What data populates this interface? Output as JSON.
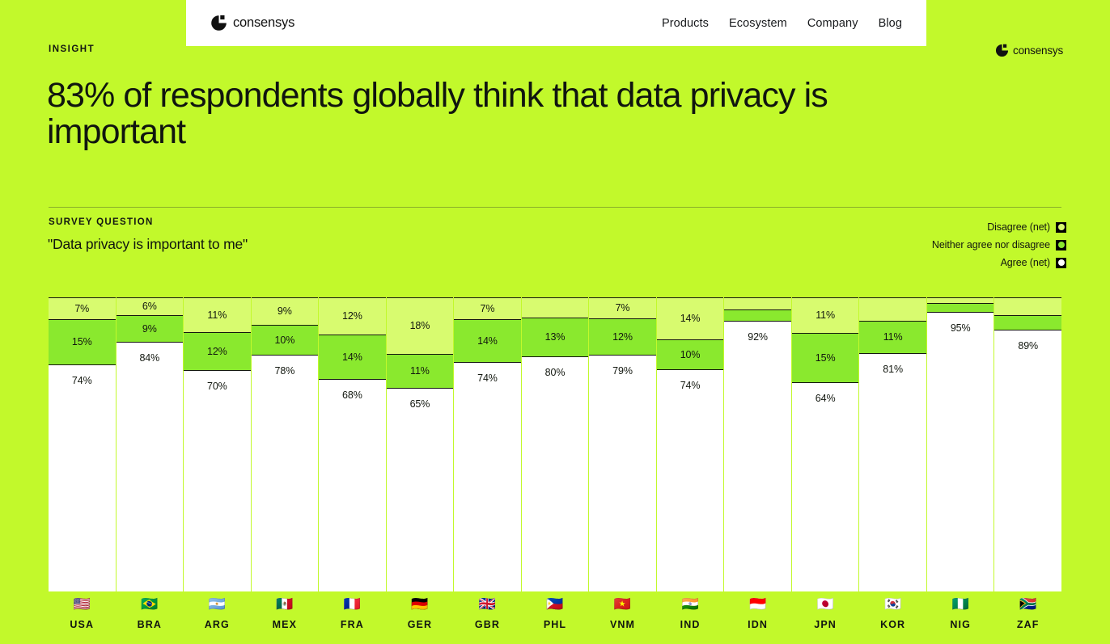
{
  "navbar": {
    "brand": "consensys",
    "brand_icon": "consensys-logo-icon",
    "links": [
      {
        "label": "Products"
      },
      {
        "label": "Ecosystem"
      },
      {
        "label": "Company"
      },
      {
        "label": "Blog"
      }
    ]
  },
  "corner_logo": {
    "brand": "consensys",
    "icon": "consensys-logo-icon"
  },
  "hero": {
    "eyebrow": "INSIGHT",
    "headline": "83% of respondents globally think that data privacy is important"
  },
  "survey": {
    "label": "SURVEY QUESTION",
    "question": "\"Data privacy is important to me\""
  },
  "legend": {
    "items": [
      {
        "label": "Disagree (net)",
        "color": "#d8fb6f"
      },
      {
        "label": "Neither agree nor disagree",
        "color": "#8ae92e"
      },
      {
        "label": "Agree (net)",
        "color": "#ffffff"
      }
    ]
  },
  "colors": {
    "background": "#c2f92b",
    "disagree": "#d8fb6f",
    "neither": "#8ae92e",
    "agree": "#ffffff",
    "stroke": "#13170f"
  },
  "chart_data": {
    "type": "bar",
    "title": "\"Data privacy is important to me\"",
    "subtype": "stacked-100-percent-vertical",
    "xlabel": "",
    "ylabel": "",
    "ylim": [
      0,
      100
    ],
    "grid": false,
    "legend_position": "top-right",
    "categories": [
      "USA",
      "BRA",
      "ARG",
      "MEX",
      "FRA",
      "GER",
      "GBR",
      "PHL",
      "VNM",
      "IND",
      "IDN",
      "JPN",
      "KOR",
      "NIG",
      "ZAF"
    ],
    "category_icons": [
      "🇺🇸",
      "🇧🇷",
      "🇦🇷",
      "🇲🇽",
      "🇫🇷",
      "🇩🇪",
      "🇬🇧",
      "🇵🇭",
      "🇻🇳",
      "🇮🇳",
      "🇮🇩",
      "🇯🇵",
      "🇰🇷",
      "🇳🇬",
      "🇿🇦"
    ],
    "series": [
      {
        "name": "Disagree (net)",
        "color": "#d8fb6f",
        "values": [
          7,
          6,
          11,
          9,
          12,
          18,
          7,
          7,
          7,
          14,
          4,
          11,
          8,
          2,
          6
        ]
      },
      {
        "name": "Neither agree nor disagree",
        "color": "#8ae92e",
        "values": [
          15,
          9,
          12,
          10,
          14,
          11,
          14,
          13,
          12,
          10,
          4,
          15,
          11,
          3,
          5
        ]
      },
      {
        "name": "Agree (net)",
        "color": "#ffffff",
        "values": [
          74,
          84,
          70,
          78,
          68,
          65,
          74,
          80,
          79,
          74,
          92,
          64,
          81,
          95,
          89
        ]
      }
    ],
    "bars": [
      {
        "country": "USA",
        "flag": "🇺🇸",
        "segments": [
          {
            "series": "Disagree (net)",
            "value": 7,
            "label": "7%",
            "color": "#d8fb6f"
          },
          {
            "series": "Neither agree nor disagree",
            "value": 15,
            "label": "15%",
            "color": "#8ae92e"
          },
          {
            "series": "Agree (net)",
            "value": 74,
            "label": "74%",
            "color": "#ffffff"
          }
        ]
      },
      {
        "country": "BRA",
        "flag": "🇧🇷",
        "segments": [
          {
            "series": "Disagree (net)",
            "value": 6,
            "label": "6%",
            "color": "#d8fb6f"
          },
          {
            "series": "Neither agree nor disagree",
            "value": 9,
            "label": "9%",
            "color": "#8ae92e"
          },
          {
            "series": "Agree (net)",
            "value": 84,
            "label": "84%",
            "color": "#ffffff"
          }
        ]
      },
      {
        "country": "ARG",
        "flag": "🇦🇷",
        "segments": [
          {
            "series": "Disagree (net)",
            "value": 11,
            "label": "11%",
            "color": "#d8fb6f"
          },
          {
            "series": "Neither agree nor disagree",
            "value": 12,
            "label": "12%",
            "color": "#8ae92e"
          },
          {
            "series": "Agree (net)",
            "value": 70,
            "label": "70%",
            "color": "#ffffff"
          }
        ]
      },
      {
        "country": "MEX",
        "flag": "🇲🇽",
        "segments": [
          {
            "series": "Disagree (net)",
            "value": 9,
            "label": "9%",
            "color": "#d8fb6f"
          },
          {
            "series": "Neither agree nor disagree",
            "value": 10,
            "label": "10%",
            "color": "#8ae92e"
          },
          {
            "series": "Agree (net)",
            "value": 78,
            "label": "78%",
            "color": "#ffffff"
          }
        ]
      },
      {
        "country": "FRA",
        "flag": "🇫🇷",
        "segments": [
          {
            "series": "Disagree (net)",
            "value": 12,
            "label": "12%",
            "color": "#d8fb6f"
          },
          {
            "series": "Neither agree nor disagree",
            "value": 14,
            "label": "14%",
            "color": "#8ae92e"
          },
          {
            "series": "Agree (net)",
            "value": 68,
            "label": "68%",
            "color": "#ffffff"
          }
        ]
      },
      {
        "country": "GER",
        "flag": "🇩🇪",
        "segments": [
          {
            "series": "Disagree (net)",
            "value": 18,
            "label": "18%",
            "color": "#d8fb6f"
          },
          {
            "series": "Neither agree nor disagree",
            "value": 11,
            "label": "11%",
            "color": "#8ae92e"
          },
          {
            "series": "Agree (net)",
            "value": 65,
            "label": "65%",
            "color": "#ffffff"
          }
        ]
      },
      {
        "country": "GBR",
        "flag": "🇬🇧",
        "segments": [
          {
            "series": "Disagree (net)",
            "value": 7,
            "label": "7%",
            "color": "#d8fb6f"
          },
          {
            "series": "Neither agree nor disagree",
            "value": 14,
            "label": "14%",
            "color": "#8ae92e"
          },
          {
            "series": "Agree (net)",
            "value": 74,
            "label": "74%",
            "color": "#ffffff"
          }
        ]
      },
      {
        "country": "PHL",
        "flag": "🇵🇭",
        "segments": [
          {
            "series": "Disagree (net)",
            "value": 7,
            "label": "",
            "color": "#d8fb6f"
          },
          {
            "series": "Neither agree nor disagree",
            "value": 13,
            "label": "13%",
            "color": "#8ae92e"
          },
          {
            "series": "Agree (net)",
            "value": 80,
            "label": "80%",
            "color": "#ffffff"
          }
        ]
      },
      {
        "country": "VNM",
        "flag": "🇻🇳",
        "segments": [
          {
            "series": "Disagree (net)",
            "value": 7,
            "label": "7%",
            "color": "#d8fb6f"
          },
          {
            "series": "Neither agree nor disagree",
            "value": 12,
            "label": "12%",
            "color": "#8ae92e"
          },
          {
            "series": "Agree (net)",
            "value": 79,
            "label": "79%",
            "color": "#ffffff"
          }
        ]
      },
      {
        "country": "IND",
        "flag": "🇮🇳",
        "segments": [
          {
            "series": "Disagree (net)",
            "value": 14,
            "label": "14%",
            "color": "#d8fb6f"
          },
          {
            "series": "Neither agree nor disagree",
            "value": 10,
            "label": "10%",
            "color": "#8ae92e"
          },
          {
            "series": "Agree (net)",
            "value": 74,
            "label": "74%",
            "color": "#ffffff"
          }
        ]
      },
      {
        "country": "IDN",
        "flag": "🇮🇩",
        "segments": [
          {
            "series": "Disagree (net)",
            "value": 4,
            "label": "",
            "color": "#d8fb6f"
          },
          {
            "series": "Neither agree nor disagree",
            "value": 4,
            "label": "",
            "color": "#8ae92e"
          },
          {
            "series": "Agree (net)",
            "value": 92,
            "label": "92%",
            "color": "#ffffff"
          }
        ]
      },
      {
        "country": "JPN",
        "flag": "🇯🇵",
        "segments": [
          {
            "series": "Disagree (net)",
            "value": 11,
            "label": "11%",
            "color": "#d8fb6f"
          },
          {
            "series": "Neither agree nor disagree",
            "value": 15,
            "label": "15%",
            "color": "#8ae92e"
          },
          {
            "series": "Agree (net)",
            "value": 64,
            "label": "64%",
            "color": "#ffffff"
          }
        ]
      },
      {
        "country": "KOR",
        "flag": "🇰🇷",
        "segments": [
          {
            "series": "Disagree (net)",
            "value": 8,
            "label": "",
            "color": "#d8fb6f"
          },
          {
            "series": "Neither agree nor disagree",
            "value": 11,
            "label": "11%",
            "color": "#8ae92e"
          },
          {
            "series": "Agree (net)",
            "value": 81,
            "label": "81%",
            "color": "#ffffff"
          }
        ]
      },
      {
        "country": "NIG",
        "flag": "🇳🇬",
        "segments": [
          {
            "series": "Disagree (net)",
            "value": 2,
            "label": "",
            "color": "#d8fb6f"
          },
          {
            "series": "Neither agree nor disagree",
            "value": 3,
            "label": "",
            "color": "#8ae92e"
          },
          {
            "series": "Agree (net)",
            "value": 95,
            "label": "95%",
            "color": "#ffffff"
          }
        ]
      },
      {
        "country": "ZAF",
        "flag": "🇿🇦",
        "segments": [
          {
            "series": "Disagree (net)",
            "value": 6,
            "label": "",
            "color": "#d8fb6f"
          },
          {
            "series": "Neither agree nor disagree",
            "value": 5,
            "label": "",
            "color": "#8ae92e"
          },
          {
            "series": "Agree (net)",
            "value": 89,
            "label": "89%",
            "color": "#ffffff"
          }
        ]
      }
    ]
  }
}
